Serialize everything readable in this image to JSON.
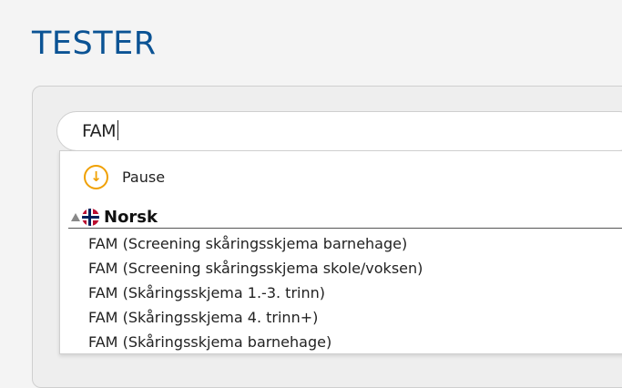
{
  "page": {
    "title": "TESTER"
  },
  "search": {
    "value": "FAM"
  },
  "dropdown": {
    "pause": {
      "label": "Pause",
      "icon": "download-circle-icon"
    },
    "group": {
      "label": "Norsk",
      "icon": "norway-flag-icon"
    },
    "options": [
      "FAM (Screening skåringsskjema barnehage)",
      "FAM (Screening skåringsskjema skole/voksen)",
      "FAM (Skåringsskjema 1.-3. trinn)",
      "FAM (Skåringsskjema 4. trinn+)",
      "FAM (Skåringsskjema barnehage)"
    ]
  },
  "colors": {
    "title": "#0b5394",
    "pause_icon": "#f0a000"
  }
}
